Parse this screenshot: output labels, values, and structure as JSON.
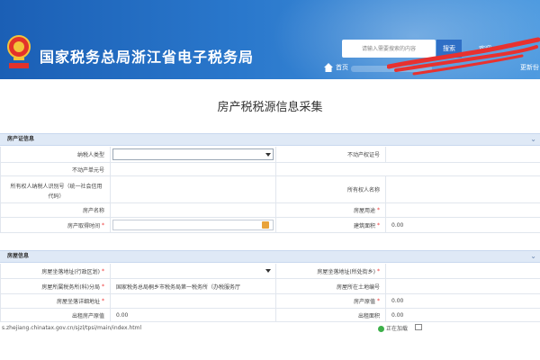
{
  "header": {
    "site_title": "国家税务总局浙江省电子税务局",
    "search_placeholder": "请输入需要搜索的内容",
    "search_button": "搜索",
    "welcome": "欢迎",
    "home_link": "首页",
    "more_link": "更新份",
    "colors": {
      "banner": "#2a78cc",
      "scribble": "#e8312f"
    }
  },
  "page_title": "房产税税源信息采集",
  "property_certificate": {
    "section_title": "房产证信息",
    "rows": [
      {
        "left_label": "纳税人类型",
        "left_type": "select",
        "left_value": "",
        "right_label": "不动产权证号",
        "right_value": ""
      },
      {
        "left_label": "不动产单元号",
        "left_value": ""
      },
      {
        "left_label": "所有权人纳税人识别号（统一社会信用代码）",
        "left_value": "",
        "right_label": "所有权人名称",
        "right_value": ""
      },
      {
        "left_label": "房产名称",
        "left_value": "",
        "right_label": "房屋用途",
        "right_required": true,
        "right_value": ""
      },
      {
        "left_label": "房产取得时间",
        "left_required": true,
        "left_type": "date",
        "left_value": "",
        "right_label": "建筑面积",
        "right_required": true,
        "right_value": "0.00"
      }
    ]
  },
  "house_info": {
    "section_title": "房屋信息",
    "rows": [
      {
        "left_label": "房屋坐落地址(行政区划)",
        "left_required": true,
        "left_type": "select",
        "left_value": "",
        "right_label": "房屋坐落地址(所处街乡)",
        "right_required": true,
        "right_type": "select",
        "right_value": ""
      },
      {
        "left_label": "房屋所属税务所(科)分局",
        "left_required": true,
        "left_value": "国家税务总局桐乡市税务局第一税务所（办税服务厅",
        "right_label": "房屋所在土地编号",
        "right_value": ""
      },
      {
        "left_label": "房屋坐落详细地址",
        "left_required": true,
        "left_value": "",
        "right_label": "房产原值",
        "right_required": true,
        "right_value": "0.00"
      },
      {
        "left_label": "出租房产原值",
        "left_value": "0.00",
        "right_label": "出租面积",
        "right_value": "0.00"
      }
    ]
  },
  "status_bar": {
    "url": "s.zhejiang.chinatax.gov.cn/sjzl/tpsi/main/index.html",
    "status_label": "正在加载",
    "zoom_icon": "zoom-box-icon"
  }
}
